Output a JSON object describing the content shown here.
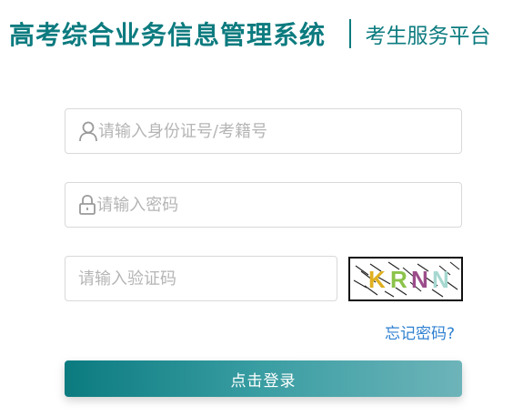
{
  "header": {
    "system_title": "高考综合业务信息管理系统",
    "portal_name": "考生服务平台"
  },
  "login_form": {
    "id_field": {
      "placeholder": "请输入身份证号/考籍号",
      "icon": "user-icon"
    },
    "password_field": {
      "placeholder": "请输入密码",
      "icon": "lock-icon"
    },
    "captcha_field": {
      "placeholder": "请输入验证码"
    },
    "captcha_image": {
      "text": "KRNN",
      "colors": [
        "#e0b020",
        "#8bc34a",
        "#9c4c8a",
        "#a6d8d0"
      ]
    },
    "forgot_password": "忘记密码?",
    "submit_label": "点击登录"
  },
  "colors": {
    "brand": "#0c7b7f",
    "link": "#2f80d1",
    "placeholder": "#b5b5b5",
    "border": "#d9d9d9"
  }
}
